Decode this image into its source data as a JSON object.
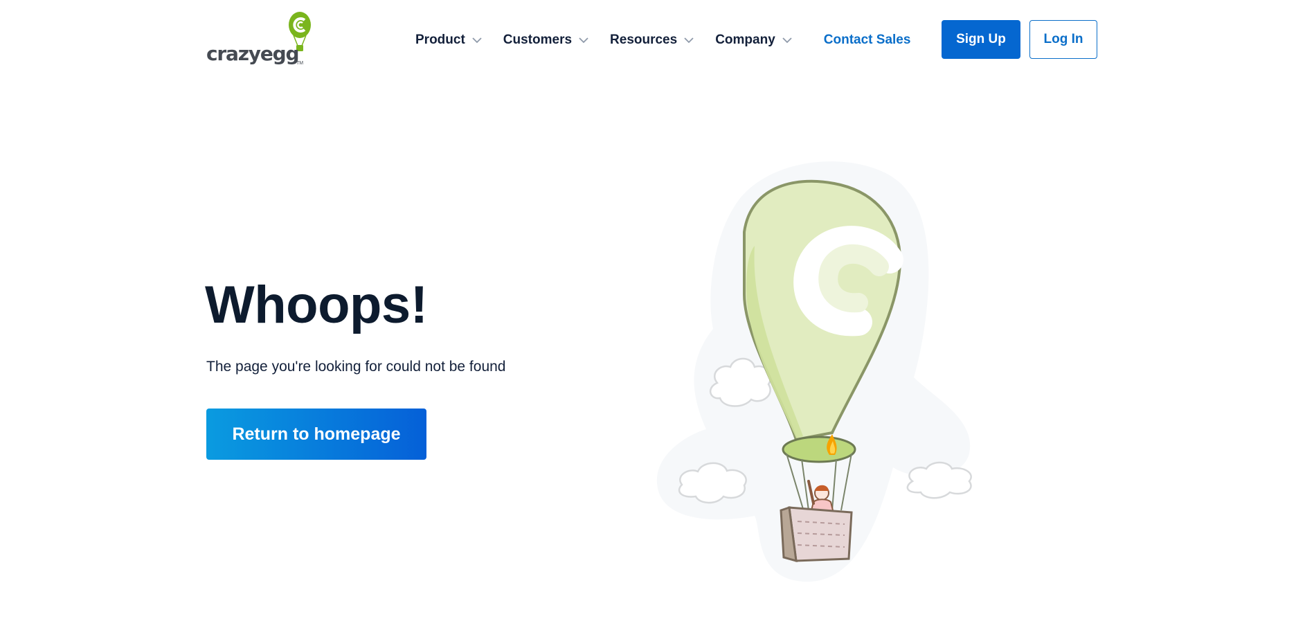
{
  "header": {
    "logo": {
      "text": "crazyegg",
      "tm": "TM",
      "icon": "balloon-logo-icon"
    },
    "nav": [
      {
        "label": "Product",
        "icon": "chevron-down-icon"
      },
      {
        "label": "Customers",
        "icon": "chevron-down-icon"
      },
      {
        "label": "Resources",
        "icon": "chevron-down-icon"
      },
      {
        "label": "Company",
        "icon": "chevron-down-icon"
      }
    ],
    "contact_label": "Contact Sales",
    "signup_label": "Sign Up",
    "login_label": "Log In"
  },
  "main": {
    "title": "Whoops!",
    "subtitle": "The page you're looking for could not be found",
    "home_button_label": "Return to homepage",
    "illustration": "hot-air-balloon-illustration"
  },
  "colors": {
    "brand_blue": "#0567d0",
    "link_blue": "#0a6ec9",
    "gradient_start": "#0a9be0",
    "gradient_end": "#0560d8",
    "balloon_green": "#d9e9b4",
    "logo_green": "#7ab51d",
    "heading": "#0d1b2e"
  }
}
